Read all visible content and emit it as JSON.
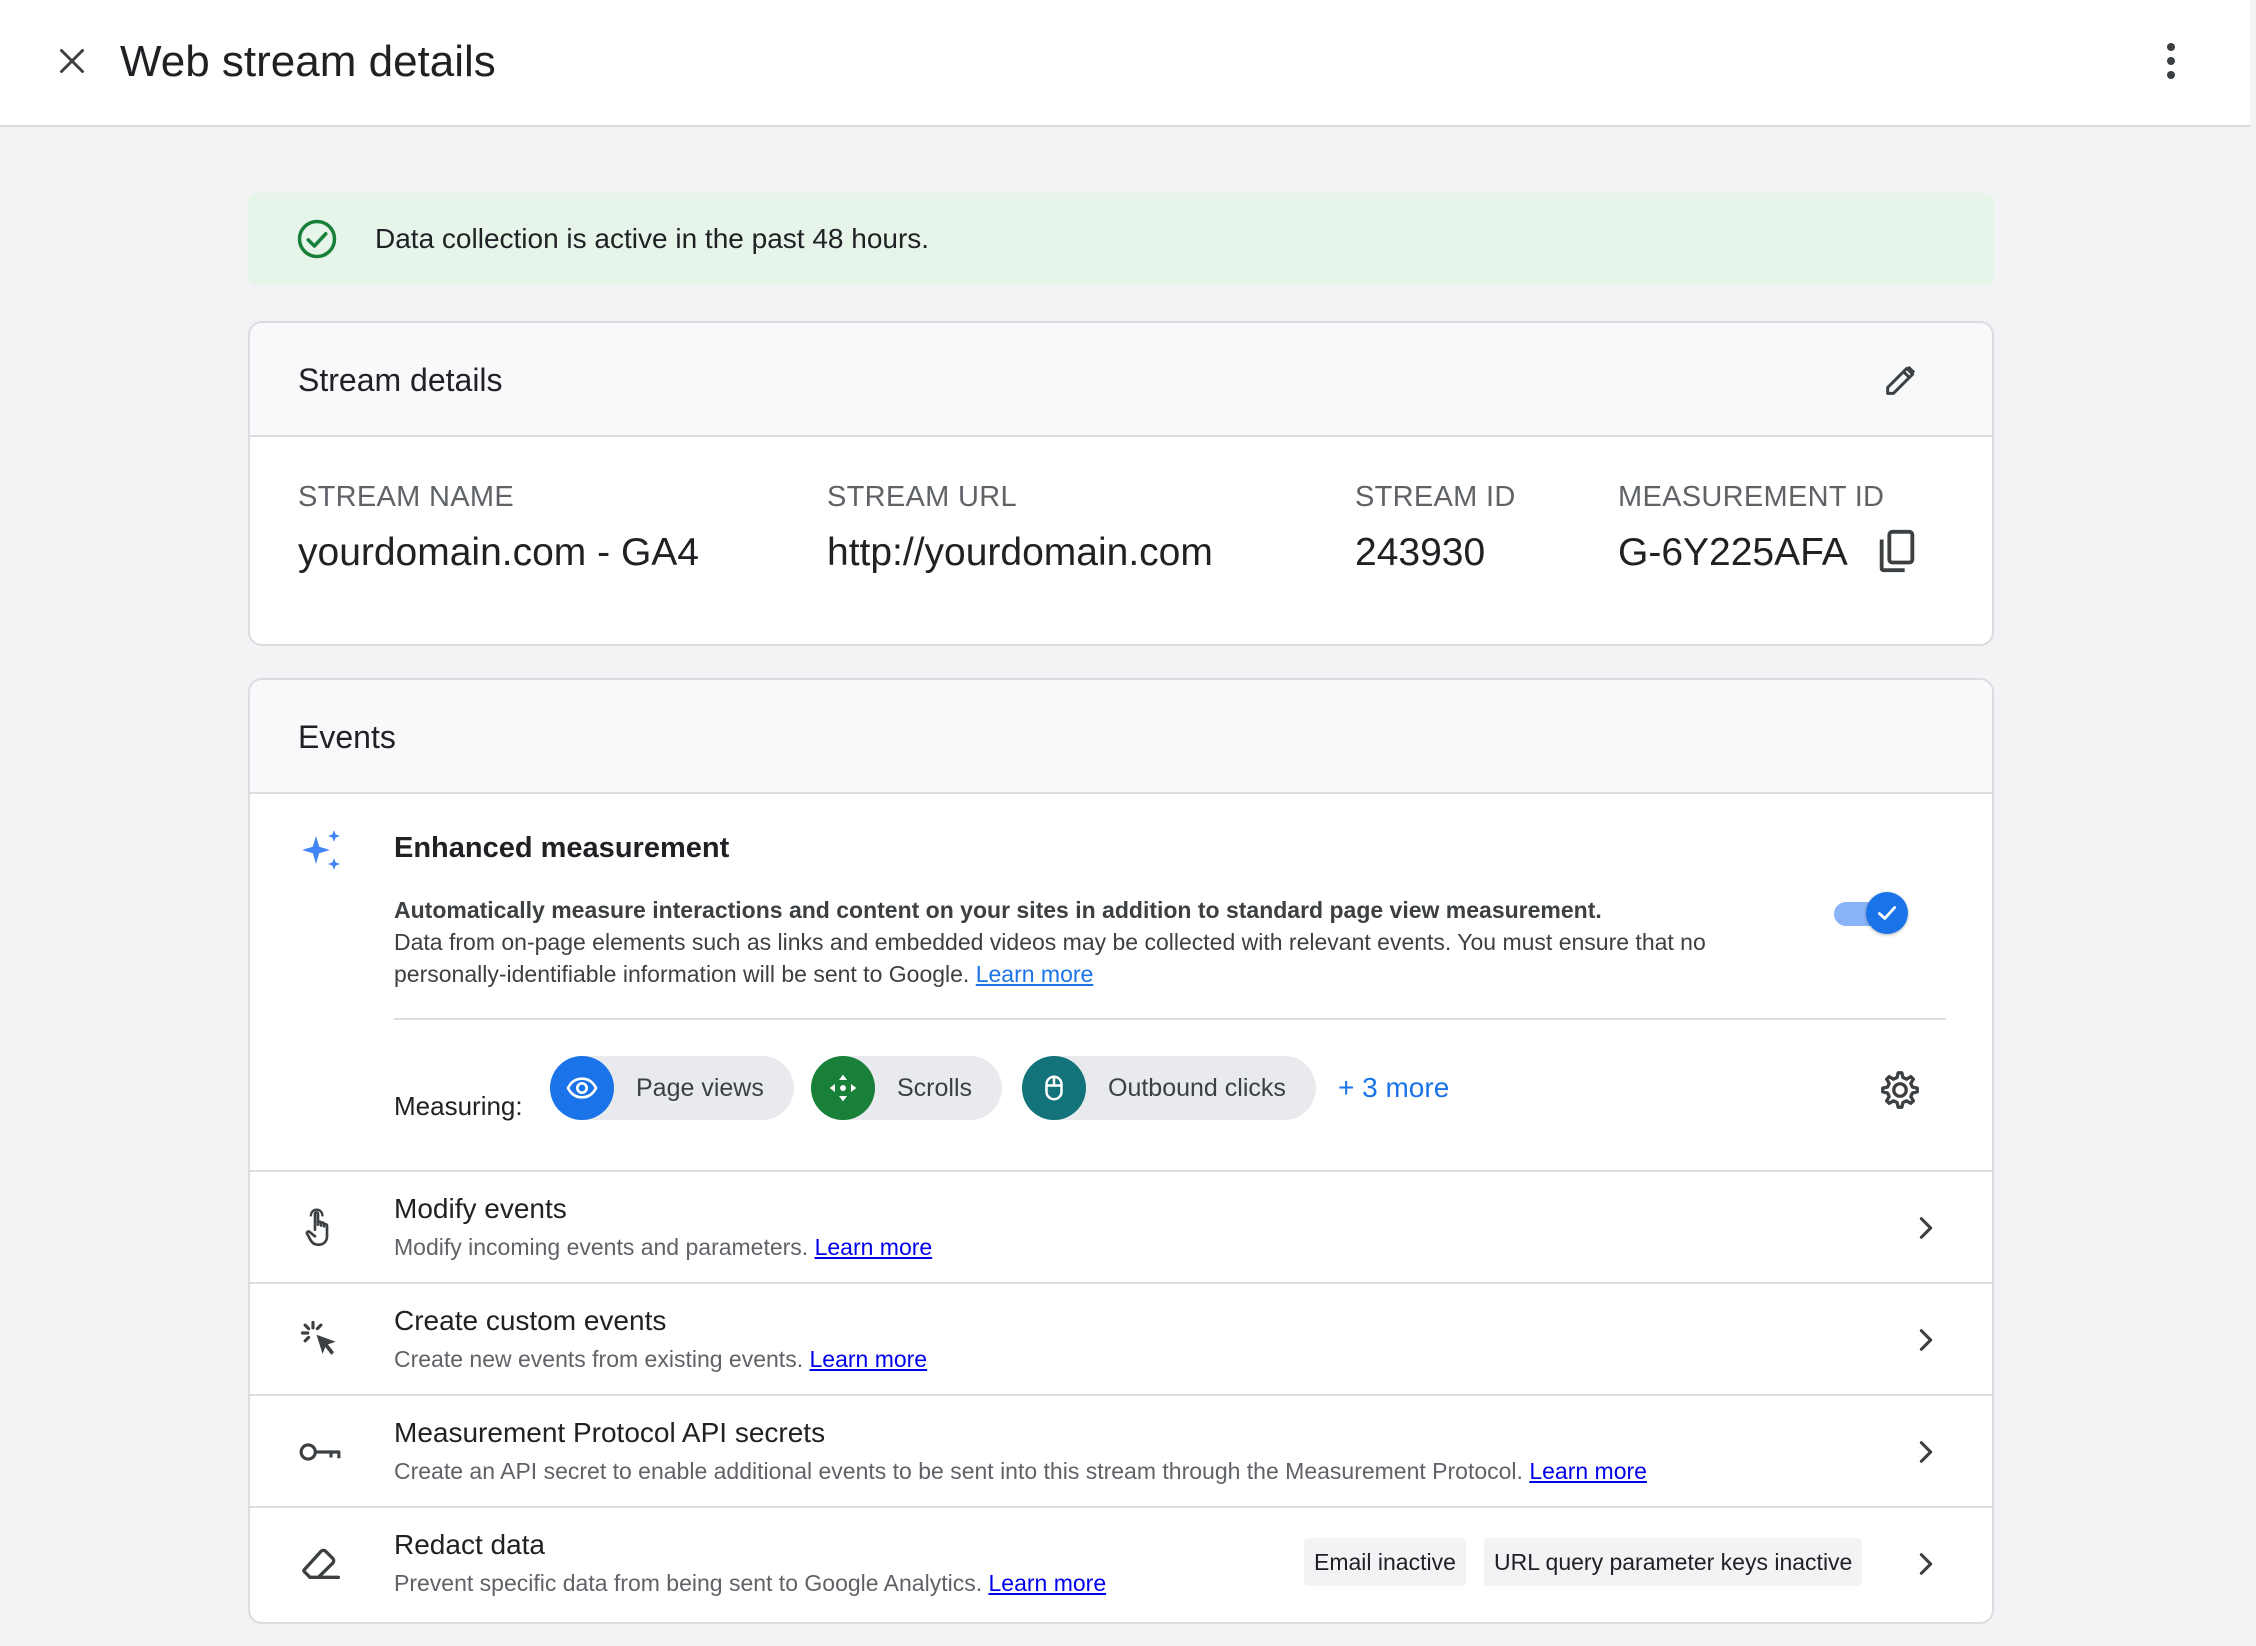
{
  "header": {
    "title": "Web stream details",
    "close_icon": "close-icon",
    "more_icon": "more-vert-icon"
  },
  "banner": {
    "text": "Data collection is active in the past 48 hours.",
    "icon": "check-circle-icon",
    "status_color": "#188038",
    "background": "#e6f4ea"
  },
  "stream_details": {
    "title": "Stream details",
    "edit_icon": "edit-pencil-icon",
    "fields": {
      "stream_name": {
        "label": "STREAM NAME",
        "value": "yourdomain.com - GA4"
      },
      "stream_url": {
        "label": "STREAM URL",
        "value": "http://yourdomain.com"
      },
      "stream_id": {
        "label": "STREAM ID",
        "value": "243930"
      },
      "measurement_id": {
        "label": "MEASUREMENT ID",
        "value": "G-6Y225AFA"
      }
    },
    "copy_icon": "copy-icon"
  },
  "events": {
    "title": "Events",
    "enhanced": {
      "title": "Enhanced measurement",
      "bold_line": "Automatically measure interactions and content on your sites in addition to standard page view measurement.",
      "desc": "Data from on-page elements such as links and embedded videos may be collected with relevant events. You must ensure that no personally-identifiable information will be sent to Google.",
      "learn_more": "Learn more",
      "toggle_on": true,
      "measuring_label": "Measuring:",
      "chips": [
        {
          "label": "Page views",
          "icon": "eye-icon",
          "color": "#1a73e8"
        },
        {
          "label": "Scrolls",
          "icon": "scroll-arrows-icon",
          "color": "#188038"
        },
        {
          "label": "Outbound clicks",
          "icon": "mouse-icon",
          "color": "#12737a"
        }
      ],
      "more_link": "+ 3 more",
      "settings_icon": "gear-icon",
      "accent": "#1a73e8"
    },
    "rows": [
      {
        "title": "Modify events",
        "desc": "Modify incoming events and parameters.",
        "learn_more": "Learn more",
        "icon": "touch-hand-icon"
      },
      {
        "title": "Create custom events",
        "desc": "Create new events from existing events.",
        "learn_more": "Learn more",
        "icon": "cursor-click-icon"
      },
      {
        "title": "Measurement Protocol API secrets",
        "desc": "Create an API secret to enable additional events to be sent into this stream through the Measurement Protocol.",
        "learn_more": "Learn more",
        "icon": "key-icon"
      },
      {
        "title": "Redact data",
        "desc": "Prevent specific data from being sent to Google Analytics.",
        "learn_more": "Learn more",
        "icon": "eraser-icon",
        "tags": [
          "Email inactive",
          "URL query parameter keys inactive"
        ]
      }
    ]
  }
}
